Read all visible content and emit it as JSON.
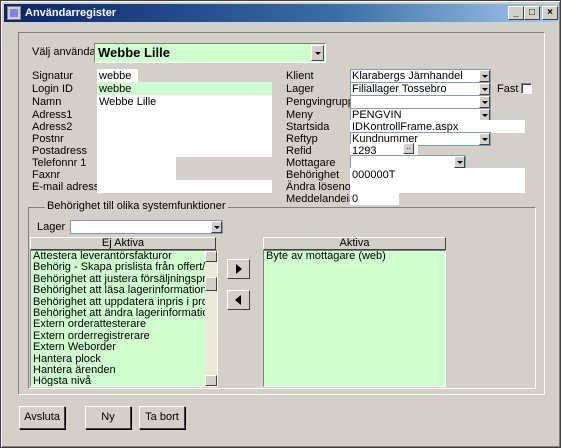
{
  "window": {
    "title": "Användarregister",
    "minimize": "_",
    "maximize": "□",
    "close": "×"
  },
  "user_select": {
    "label": "Välj användare",
    "value": "Webbe Lille"
  },
  "left_fields": [
    {
      "label": "Signatur",
      "value": "webbe"
    },
    {
      "label": "Login ID",
      "value": "webbe"
    },
    {
      "label": "Namn",
      "value": "Webbe Lille"
    },
    {
      "label": "Adress1",
      "value": ""
    },
    {
      "label": "Adress2",
      "value": ""
    },
    {
      "label": "Postnr",
      "value": ""
    },
    {
      "label": "Postadress",
      "value": ""
    },
    {
      "label": "Telefonnr 1",
      "value": ""
    },
    {
      "label": "Faxnr",
      "value": ""
    },
    {
      "label": "E-mail adress",
      "value": ""
    }
  ],
  "right_fields": [
    {
      "label": "Klient",
      "value": "Klarabergs  Järnhandel"
    },
    {
      "label": "Lager",
      "value": "Filiallager Tossebro"
    },
    {
      "label": "Pengvingrupp",
      "value": ""
    },
    {
      "label": "Meny",
      "value": "PENGVIN"
    },
    {
      "label": "Startsida",
      "value": "IDKontrollFrame.aspx"
    },
    {
      "label": "Reftyp",
      "value": "Kundnummer"
    },
    {
      "label": "Refid",
      "value": "1293"
    },
    {
      "label": "Mottagare",
      "value": ""
    },
    {
      "label": "Behörighet",
      "value": "000000T"
    },
    {
      "label": "Ändra lösenord",
      "value": ""
    },
    {
      "label": "Meddelandeint",
      "value": "0"
    }
  ],
  "fast": {
    "label": "Fast",
    "checked": false
  },
  "permissions": {
    "group_label": "Behörighet till olika systemfunktioner",
    "lager_label": "Lager",
    "lager_value": "",
    "inactive_header": "Ej Aktiva",
    "active_header": "Aktiva",
    "inactive": [
      "Attestera leverantörsfakturor",
      "Behörig - Skapa prislista från offert/order.",
      "Behörighet att justera försäljningspriser",
      "Behörighet att läsa lagerinformation",
      "Behörighet att uppdatera inpris i produktreg",
      "Behörighet att ändra lagerinformation",
      "Extern orderattesterare",
      "Extern orderregistrerare",
      "Extern Weborder",
      "Hantera plock",
      "Hantera ärenden",
      "Högsta nivå"
    ],
    "active": [
      "Byte av mottagare (web)"
    ],
    "icons": {
      "add": "arrow-right-icon",
      "remove": "arrow-left-icon"
    }
  },
  "buttons": {
    "close": "Avsluta",
    "new": "Ny",
    "delete": "Ta bort"
  }
}
